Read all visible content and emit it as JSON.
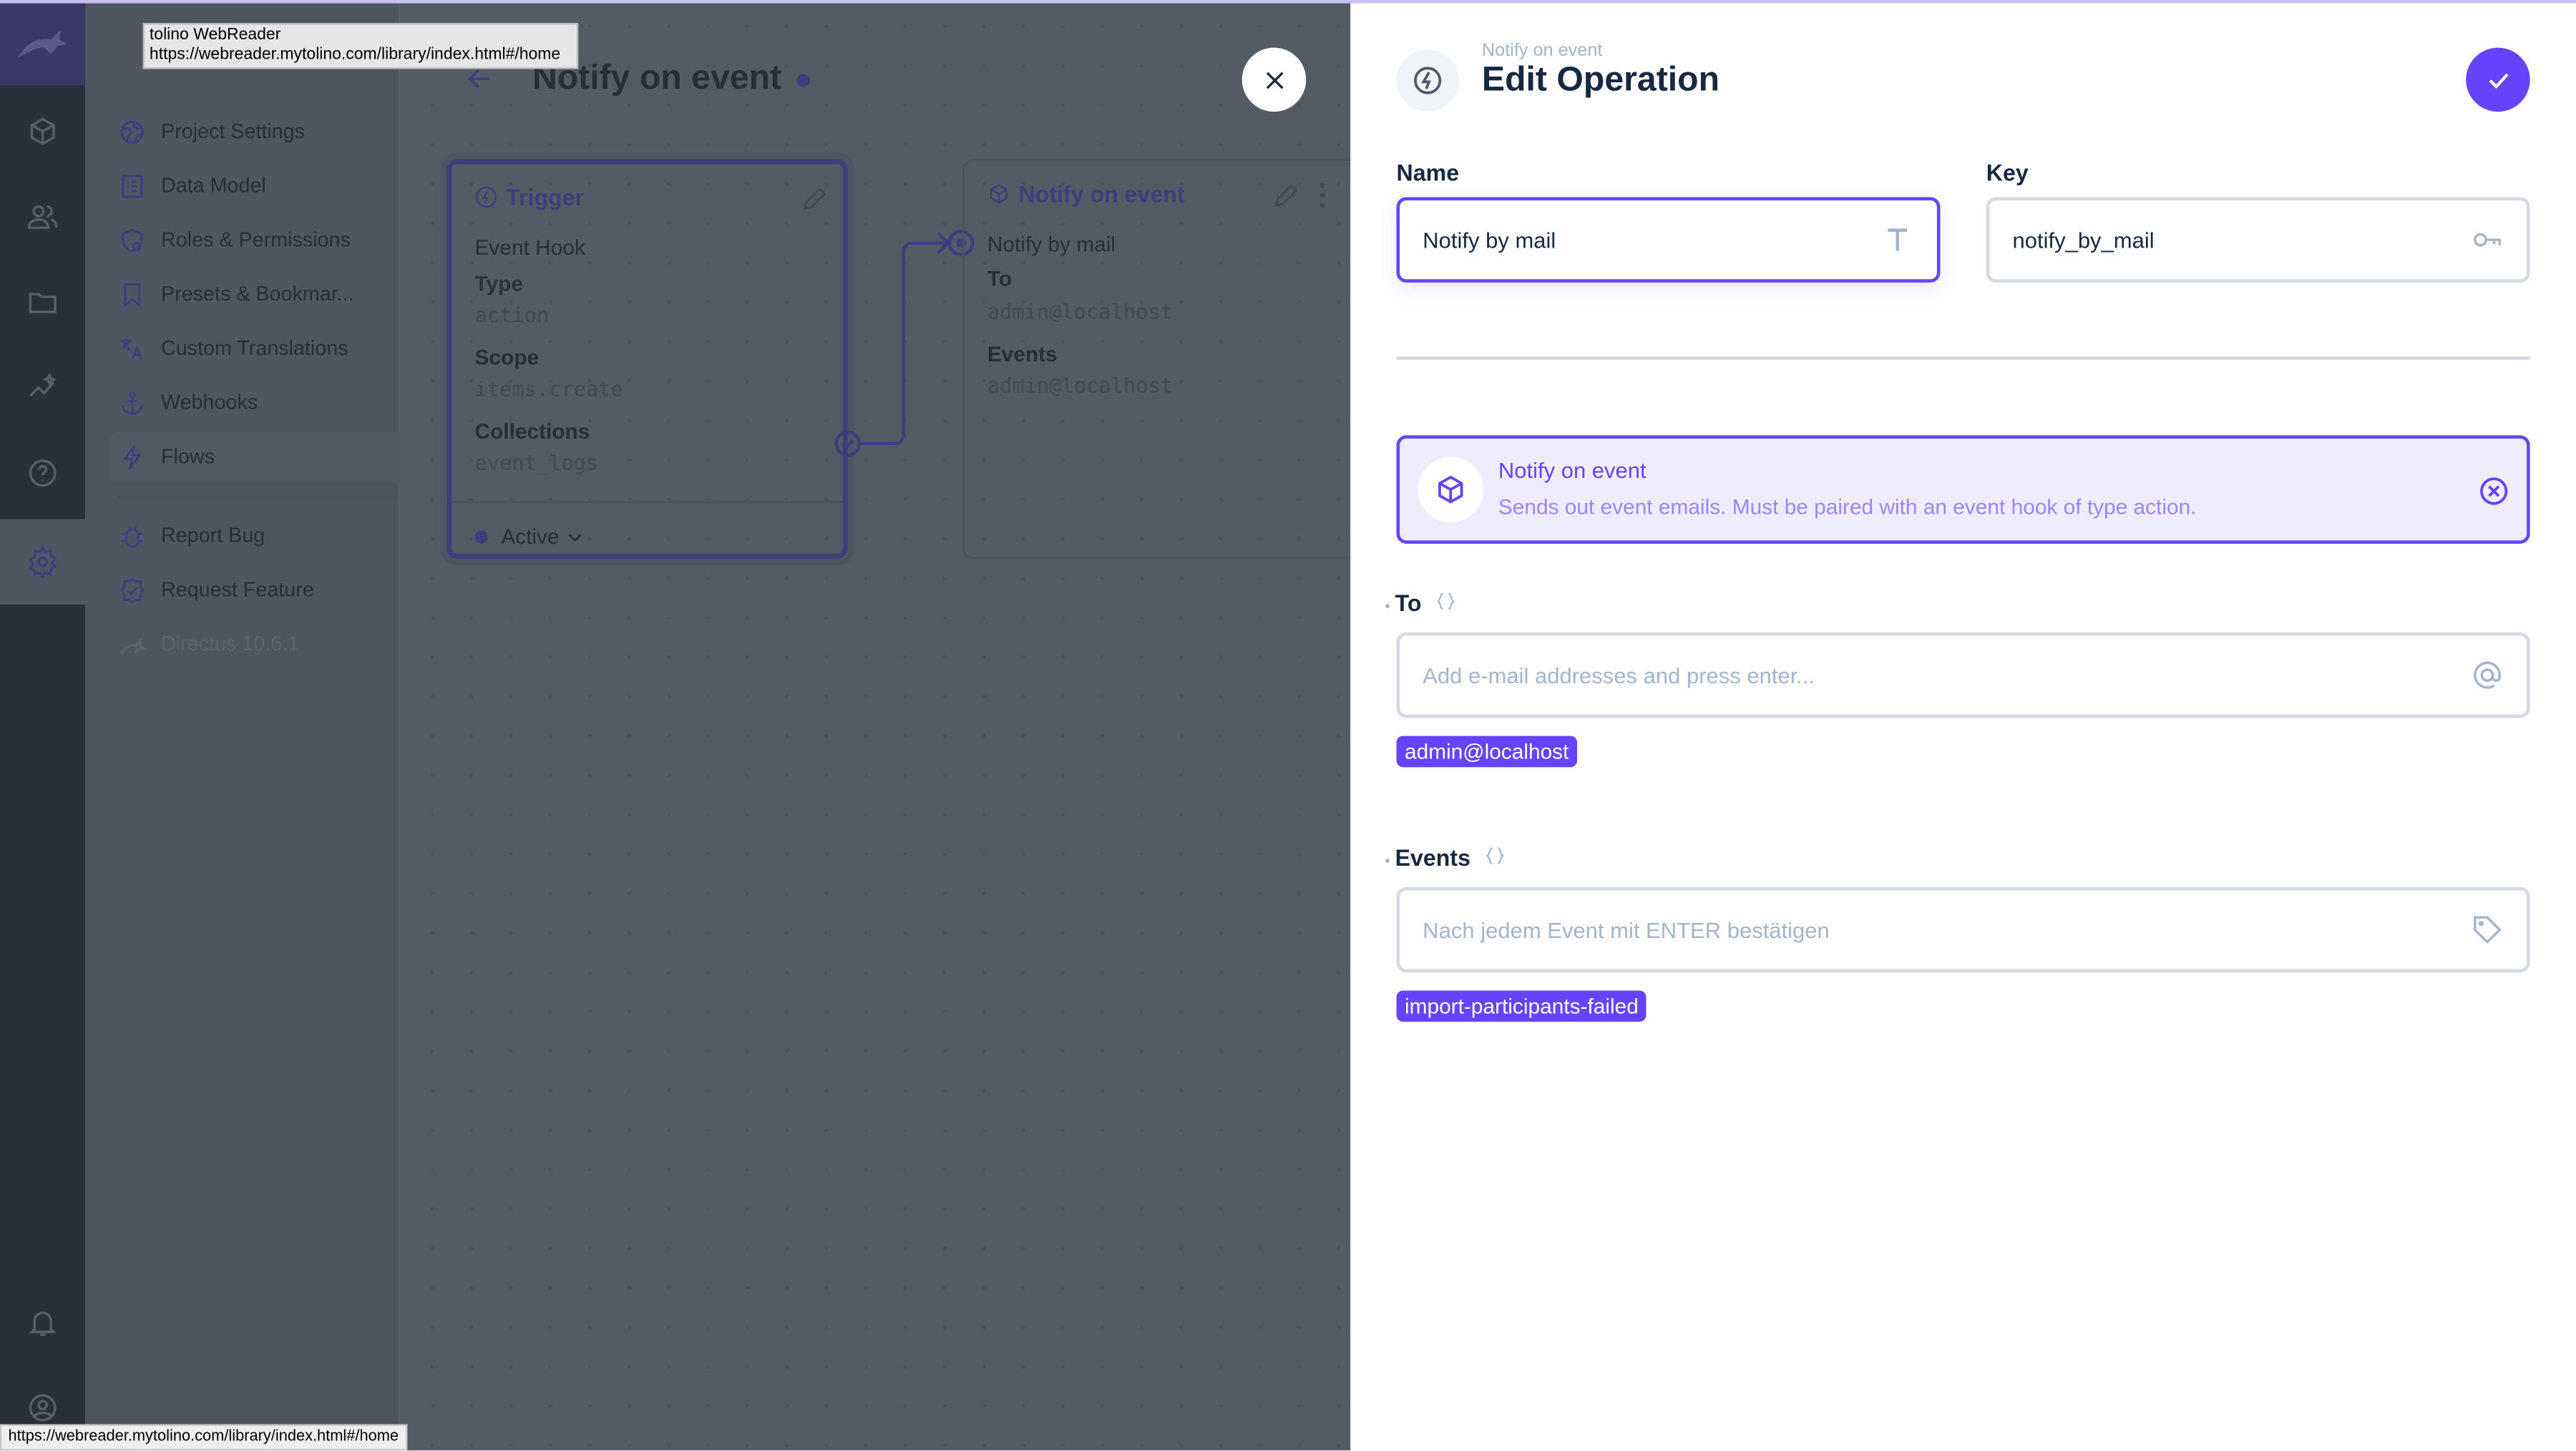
{
  "tooltip": {
    "title": "tolino WebReader",
    "url": "https://webreader.mytolino.com/library/index.html#/home"
  },
  "status_bar": {
    "url": "https://webreader.mytolino.com/library/index.html#/home"
  },
  "colors": {
    "accent": "#6644ff",
    "accent_light": "#f0ecff",
    "text": "#172940",
    "muted": "#a2b5cd"
  },
  "rail": {
    "icons": [
      "directus-logo",
      "cube-icon",
      "users-icon",
      "folder-icon",
      "insights-icon",
      "help-icon",
      "settings-icon",
      "bell-icon",
      "user-icon"
    ]
  },
  "nav": {
    "items": [
      {
        "label": "Project Settings",
        "icon": "globe-icon"
      },
      {
        "label": "Data Model",
        "icon": "list-icon"
      },
      {
        "label": "Roles & Permissions",
        "icon": "shield-icon"
      },
      {
        "label": "Presets & Bookmar...",
        "icon": "bookmark-icon"
      },
      {
        "label": "Custom Translations",
        "icon": "translate-icon"
      },
      {
        "label": "Webhooks",
        "icon": "anchor-icon"
      },
      {
        "label": "Flows",
        "icon": "bolt-icon"
      }
    ],
    "secondary": [
      {
        "label": "Report Bug",
        "icon": "bug-icon"
      },
      {
        "label": "Request Feature",
        "icon": "verified-icon"
      }
    ],
    "version": "Directus 10.6.1"
  },
  "flow": {
    "title": "Notify on event",
    "trigger": {
      "title": "Trigger",
      "subtitle": "Event Hook",
      "type_label": "Type",
      "type": "action",
      "scope_label": "Scope",
      "scope": "items.create",
      "collections_label": "Collections",
      "collections": "event_logs",
      "status": "Active"
    },
    "operation": {
      "title": "Notify on event",
      "name": "Notify by mail",
      "to_label": "To",
      "to": "admin@localhost",
      "events_label": "Events",
      "events": "admin@localhost"
    }
  },
  "drawer": {
    "subtitle": "Notify on event",
    "title": "Edit Operation",
    "name_label": "Name",
    "name_value": "Notify by mail",
    "key_label": "Key",
    "key_value": "notify_by_mail",
    "operation_card": {
      "title": "Notify on event",
      "description": "Sends out event emails. Must be paired with an event hook of type action."
    },
    "to_label": "To",
    "to_placeholder": "Add e-mail addresses and press enter...",
    "to_chips": [
      "admin@localhost"
    ],
    "events_label": "Events",
    "events_placeholder": "Nach jedem Event mit ENTER bestätigen",
    "events_chips": [
      "import-participants-failed"
    ],
    "required_mark": "•"
  }
}
